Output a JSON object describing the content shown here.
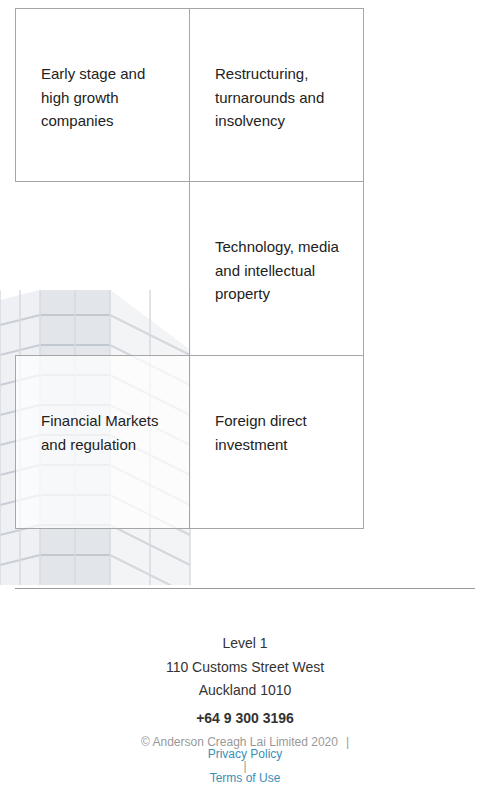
{
  "services": [
    {
      "label": "Early stage and high growth companies"
    },
    {
      "label": "Restructuring, turnarounds and insolvency"
    },
    {
      "label": "Technology, media and intellectual property"
    },
    {
      "label": "Financial Markets and regulation"
    },
    {
      "label": "Foreign direct investment"
    }
  ],
  "footer": {
    "address": [
      "Level 1",
      "110 Customs Street West",
      "Auckland 1010"
    ],
    "phone": "+64 9 300 3196",
    "copyright": "© Anderson Creagh Lai Limited 2020",
    "separator": "|",
    "links": [
      {
        "label": "Privacy Policy"
      },
      {
        "label": "Terms of Use"
      }
    ]
  }
}
